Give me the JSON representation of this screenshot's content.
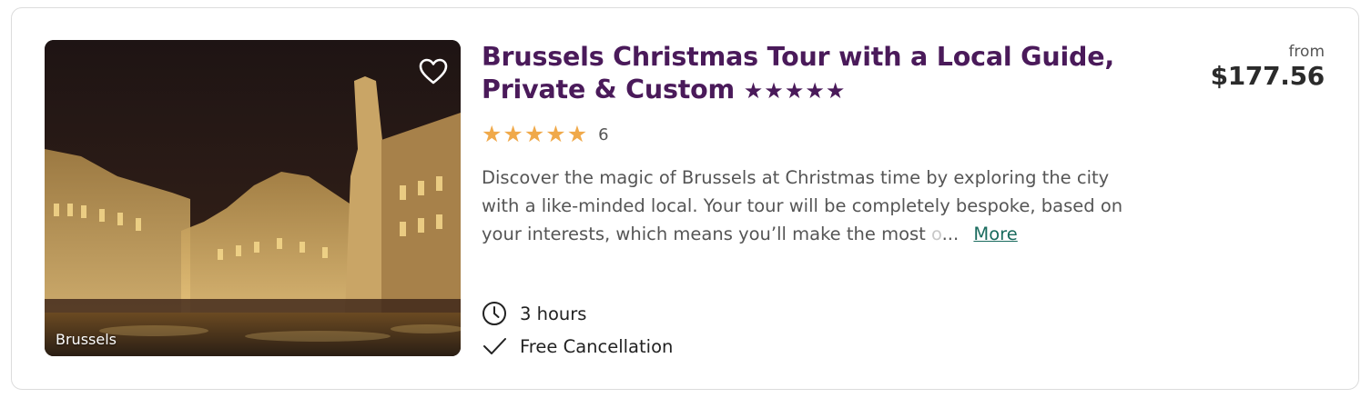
{
  "listing": {
    "title": "Brussels Christmas Tour with a Local Guide, Private & Custom",
    "title_stars": "★★★★★",
    "image_location_label": "Brussels",
    "favorite_icon": "heart-outline-icon",
    "rating": {
      "stars": 5,
      "max": 5,
      "review_count": "6",
      "star_color": "#f0a94a"
    },
    "description": "Discover the magic of Brussels at Christmas time by exploring the city with a like-minded local. Your tour will be completely bespoke, based on your interests, which means you’ll make the most",
    "description_fade": "o",
    "description_ellipsis": "...",
    "more_label": "More",
    "features": [
      {
        "icon": "clock-icon",
        "label": "3 hours"
      },
      {
        "icon": "checkmark-icon",
        "label": "Free Cancellation"
      }
    ],
    "price": {
      "from_label": "from",
      "amount": "$177.56"
    }
  },
  "colors": {
    "title": "#4a1a5a",
    "link": "#1a6b5e",
    "star": "#f0a94a"
  }
}
